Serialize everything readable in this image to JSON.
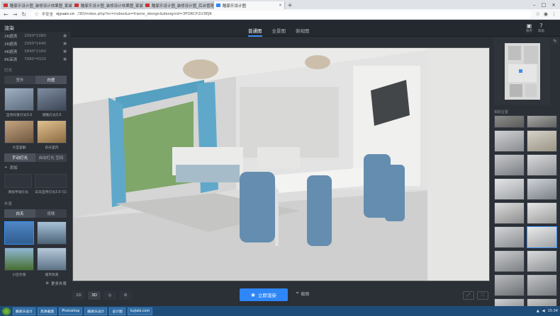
{
  "browser": {
    "tabs": [
      {
        "label": "酷家乐设计图_装修设计效果图_家装效果图"
      },
      {
        "label": "酷家乐设计图_装修设计效果图_家装效果"
      },
      {
        "label": "酷家乐设计图_装修设计图_后台管理"
      },
      {
        "label": "酷家乐设计图"
      }
    ],
    "new_tab": "+",
    "url_secure": "不安全",
    "url_host": "sjyuan.cn",
    "url_path": "/3D/index.php?m=index&a=frame_design&designid=3FOKCP2U3EJK"
  },
  "app": {
    "title": "渲染",
    "view_tabs": [
      "普通图",
      "全景图",
      "俯视图"
    ],
    "active_view": "普通图",
    "head_icons": [
      {
        "icon": "save-icon",
        "label": "保存"
      },
      {
        "icon": "help-icon",
        "label": "帮助"
      }
    ]
  },
  "left": {
    "resolutions": [
      {
        "name": "2K超清",
        "value": "2560*1080"
      },
      {
        "name": "2K超清",
        "value": "2560*1440"
      },
      {
        "name": "4K超清",
        "value": "3840*2160"
      },
      {
        "name": "8K高清",
        "value": "7680*4320"
      }
    ],
    "light_label": "灯光",
    "light_toggle": [
      "室外",
      "白昼"
    ],
    "light_thumbs": [
      {
        "caption": "自然日景灯光3.0",
        "color": "#7d8ea0"
      },
      {
        "caption": "夜晚灯光3.0",
        "color": "#5e6a7a"
      },
      {
        "caption": "大堂室解",
        "color": "#a58a6b"
      },
      {
        "caption": "白天室内",
        "color": "#c9a879"
      }
    ],
    "custom_toggle": [
      "手动灯光",
      "自动灯光 空间"
    ],
    "add_label": "添加",
    "custom_thumbs": [
      {
        "caption": "添加手动灯光",
        "color": "#3a3f48"
      },
      {
        "caption": "白天自然灯光3.0 (1)",
        "color": "#3a3f48"
      }
    ],
    "env_label": "外景",
    "env_toggle": [
      "白天",
      "夜晚"
    ],
    "env_thumbs": [
      {
        "caption": "",
        "color": "#4d7fb3"
      },
      {
        "caption": "",
        "color": "#6b8fa8"
      },
      {
        "caption": "小区外景",
        "color": "#5f8a4a"
      },
      {
        "caption": "城市风景",
        "color": "#7e95ab"
      }
    ],
    "more_label": "更多外景"
  },
  "bottom": {
    "mode_2d": "2D",
    "mode_3d": "3D",
    "render_button": "立即渲染",
    "capture_button": "截图"
  },
  "right": {
    "section_label": "相机位置"
  },
  "taskbar": {
    "items": [
      "酷家乐设计",
      "高清截图",
      "Photoshop",
      "酷家乐设计",
      "设计图",
      "kujiale.com"
    ],
    "clock": "15:34"
  }
}
